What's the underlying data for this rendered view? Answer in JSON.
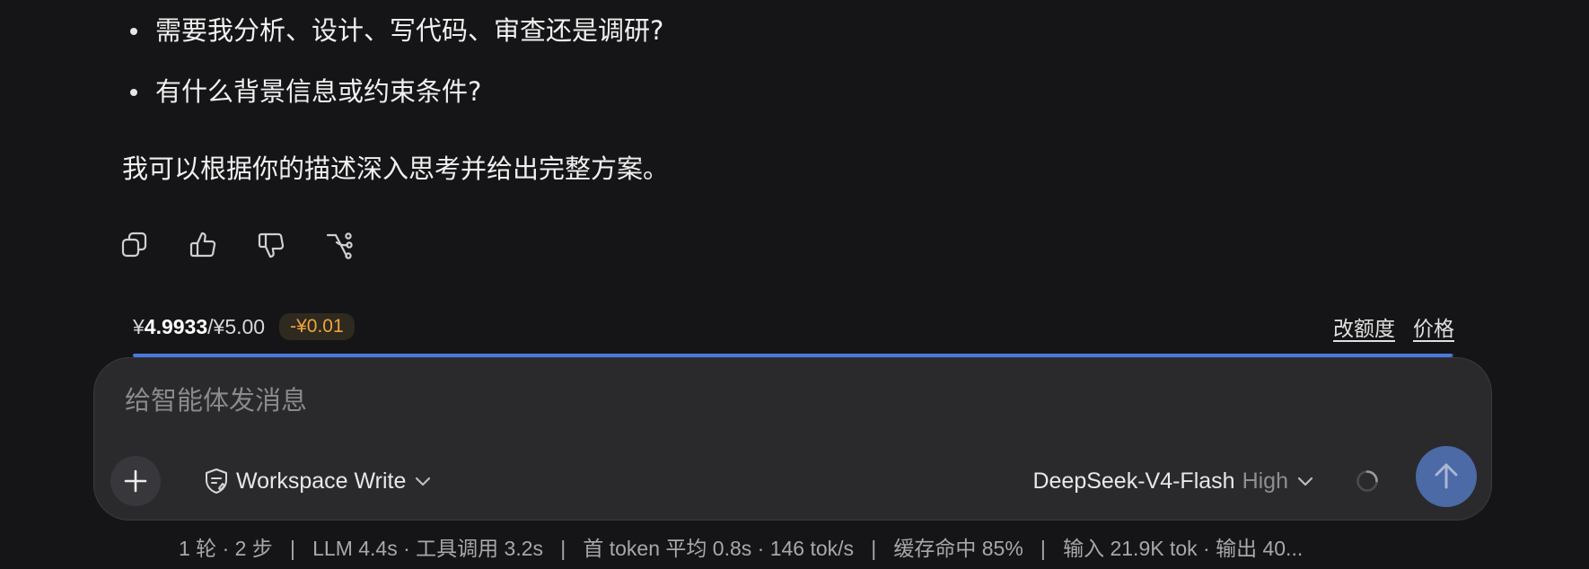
{
  "message": {
    "bullets": [
      "需要我分析、设计、写代码、审查还是调研?",
      "有什么背景信息或约束条件?"
    ],
    "closing": "我可以根据你的描述深入思考并给出完整方案。"
  },
  "actions": {
    "copy": "copy-icon",
    "like": "thumbs-up-icon",
    "dislike": "thumbs-down-icon",
    "branch": "branch-icon"
  },
  "quota": {
    "currency": "¥",
    "balance": "4.9933",
    "limit": "/¥5.00",
    "delta": "-¥0.01",
    "change_quota_label": "改额度",
    "price_label": "价格",
    "remaining_fraction": 0.99866
  },
  "composer": {
    "placeholder": "给智能体发消息",
    "mode_label": "Workspace Write",
    "model_name": "DeepSeek-V4-Flash",
    "reasoning_level": "High"
  },
  "stats": {
    "text": "1 轮 · 2 步   |   LLM 4.4s · 工具调用 3.2s   |   首 token 平均 0.8s · 146 tok/s   |   缓存命中 85%   |   输入 21.9K tok · 输出 40..."
  },
  "colors": {
    "background": "#151517",
    "composer": "#2a2a2d",
    "accent": "#4a78e0",
    "send": "#4b6aa6",
    "delta": "#f0a43a"
  }
}
